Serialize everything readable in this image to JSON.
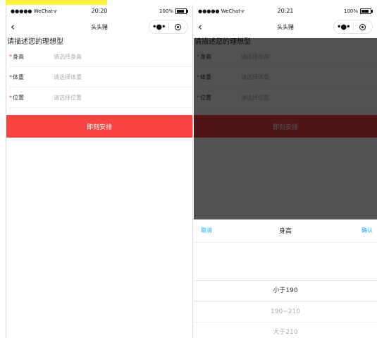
{
  "status": {
    "carrier": "●●●●● WeChat",
    "wifi_icon": "wifi-icon",
    "battery": "100%"
  },
  "screens": [
    {
      "time": "20:20"
    },
    {
      "time": "20:21"
    }
  ],
  "nav": {
    "title": "头头赌",
    "menu": "•●•"
  },
  "form": {
    "heading": "请描述您的理想型",
    "required_mark": "*",
    "fields": [
      {
        "label": "身高",
        "placeholder": "请选择身高"
      },
      {
        "label": "体重",
        "placeholder": "请选择体重"
      },
      {
        "label": "位置",
        "placeholder": "请选择位置"
      }
    ],
    "submit": "即刻安排"
  },
  "picker": {
    "cancel": "取消",
    "title": "身高",
    "confirm": "确认",
    "options": [
      "小于190",
      "190~210",
      "大于210"
    ],
    "selected_index": 0
  },
  "colors": {
    "primary": "#f94242",
    "link": "#1aa7e8",
    "highlight": "#fbf13a"
  }
}
